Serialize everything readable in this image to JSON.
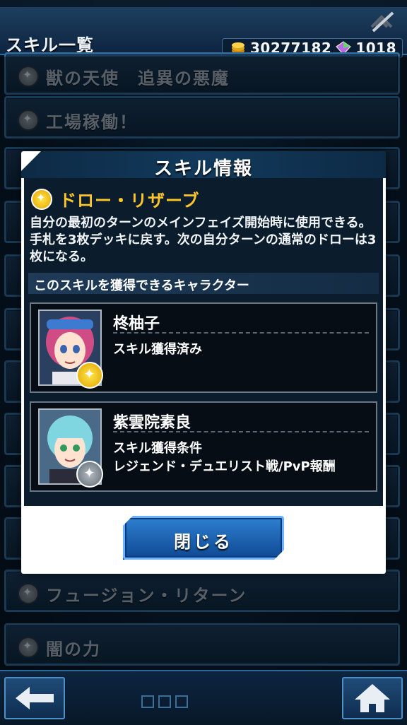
{
  "header": {
    "title": "スキル一覧",
    "coins": "30277182",
    "gems": "1018"
  },
  "skill_list": [
    {
      "label": "獣の天使　追異の悪魔"
    },
    {
      "label": "工場稼働！"
    },
    {
      "label": "フュージョン・リターン"
    },
    {
      "label": "闇の力"
    }
  ],
  "dialog": {
    "title": "スキル情報",
    "skill_name": "ドロー・リザーブ",
    "description": "自分の最初のターンのメインフェイズ開始時に使用できる。手札を3枚デッキに戻す。次の自分ターンの通常のドローは3枚になる。",
    "section_label": "このスキルを獲得できるキャラクター",
    "characters": [
      {
        "name": "柊柚子",
        "line1": "スキル獲得済み",
        "line2": ""
      },
      {
        "name": "紫雲院素良",
        "line1": "スキル獲得条件",
        "line2": "レジェンド・デュエリスト戦/PvP報酬"
      }
    ],
    "close_label": "閉じる"
  },
  "colors": {
    "accent_gold": "#ffc629",
    "panel_border": "#2f6a99",
    "button_blue": "#1f66b8"
  },
  "icons": [
    "network-off-icon",
    "coin-icon",
    "gem-icon",
    "star-icon",
    "back-arrow-icon",
    "home-icon"
  ]
}
